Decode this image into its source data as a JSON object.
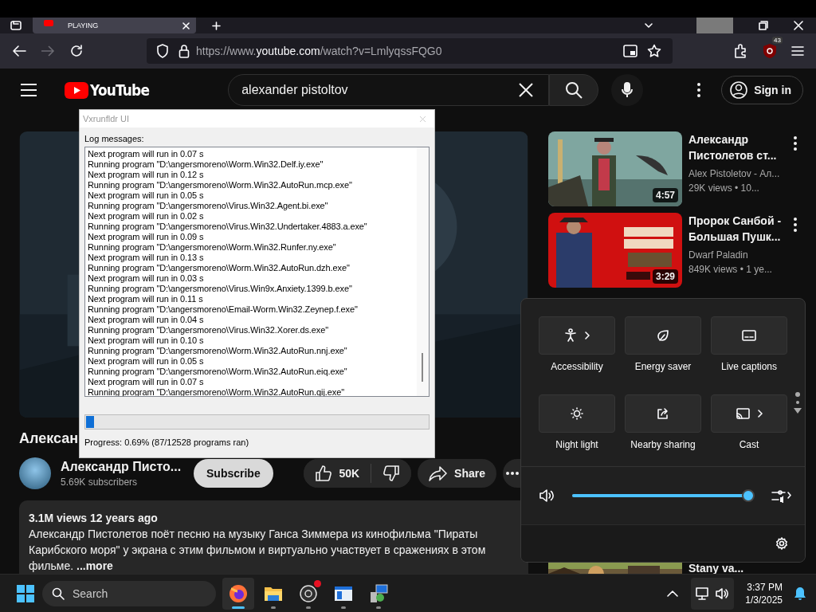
{
  "browser": {
    "tab": {
      "label": "PLAYING"
    },
    "url": "https://www.**youtube.com**/watch?v=LmlyqssFQG0",
    "extension_badge": "43"
  },
  "youtube": {
    "logo": "YouTube",
    "search": {
      "value": "alexander pistoltov"
    },
    "sign_in": "Sign in",
    "video": {
      "title": "Алексан",
      "channel": "Александр Писто...",
      "subscribers": "5.69K subscribers",
      "subscribe": "Subscribe",
      "likes": "50K",
      "share": "Share",
      "stats": "3.1M views  12 years ago",
      "description": "Александр Пистолетов поёт песню на музыку Ганса Зиммера из кинофильма \"Пираты Карибского моря\" у экрана с этим фильмом и виртуально участвует в сражениях в этом фильме.",
      "more": "...more"
    },
    "related": [
      {
        "title": "Александр Пистолетов ст...",
        "channel": "Alex Pistoletov - Ал...",
        "meta": "29K views  • 10...",
        "duration": "4:57",
        "kind": "sea"
      },
      {
        "title": "Пророк Санбой - Большая Пушк...",
        "channel": "Dwarf Paladin",
        "meta": "849K views  • 1 ye...",
        "duration": "3:29",
        "kind": "red"
      },
      {
        "title": "Stany va...",
        "kind": "forest"
      }
    ]
  },
  "dialog": {
    "title": "Vxrunfldr UI",
    "log_label": "Log messages:",
    "log": [
      "Next program will run in 0.07 s",
      "Running program \"D:\\angersmoreno\\Worm.Win32.Delf.iy.exe\"",
      "Next program will run in 0.12 s",
      "Running program \"D:\\angersmoreno\\Worm.Win32.AutoRun.mcp.exe\"",
      "Next program will run in 0.05 s",
      "Running program \"D:\\angersmoreno\\Virus.Win32.Agent.bi.exe\"",
      "Next program will run in 0.02 s",
      "Running program \"D:\\angersmoreno\\Virus.Win32.Undertaker.4883.a.exe\"",
      "Next program will run in 0.09 s",
      "Running program \"D:\\angersmoreno\\Worm.Win32.Runfer.ny.exe\"",
      "Next program will run in 0.13 s",
      "Running program \"D:\\angersmoreno\\Worm.Win32.AutoRun.dzh.exe\"",
      "Next program will run in 0.03 s",
      "Running program \"D:\\angersmoreno\\Virus.Win9x.Anxiety.1399.b.exe\"",
      "Next program will run in 0.11 s",
      "Running program \"D:\\angersmoreno\\Email-Worm.Win32.Zeynep.f.exe\"",
      "Next program will run in 0.04 s",
      "Running program \"D:\\angersmoreno\\Virus.Win32.Xorer.ds.exe\"",
      "Next program will run in 0.10 s",
      "Running program \"D:\\angersmoreno\\Worm.Win32.AutoRun.nnj.exe\"",
      "Next program will run in 0.05 s",
      "Running program \"D:\\angersmoreno\\Worm.Win32.AutoRun.eiq.exe\"",
      "Next program will run in 0.07 s",
      "Running program \"D:\\angersmoreno\\Worm.Win32.AutoRun.qij.exe\""
    ],
    "progress": {
      "level": 0.0069
    },
    "status": "Progress: 0.69% (87/12528 programs ran)"
  },
  "quick_settings": {
    "tiles": [
      {
        "label": "Accessibility",
        "kind": "accessibility",
        "expandable": true
      },
      {
        "label": "Energy saver",
        "kind": "leaf",
        "expandable": false
      },
      {
        "label": "Live captions",
        "kind": "captions",
        "expandable": false
      },
      {
        "label": "Night light",
        "kind": "sun",
        "expandable": false
      },
      {
        "label": "Nearby sharing",
        "kind": "share",
        "expandable": false
      },
      {
        "label": "Cast",
        "kind": "cast",
        "expandable": true
      }
    ],
    "volume": {
      "level": 0.97
    }
  },
  "taskbar": {
    "search_placeholder": "Search",
    "apps": [
      {
        "kind": "firefox",
        "active": true,
        "notification": false
      },
      {
        "kind": "folder",
        "active": false,
        "notification": false
      },
      {
        "kind": "obs",
        "active": false,
        "notification": true
      },
      {
        "kind": "window",
        "active": false,
        "notification": false
      },
      {
        "kind": "installer",
        "active": false,
        "notification": false
      }
    ],
    "time": "3:37 PM",
    "date": "1/3/2025"
  }
}
